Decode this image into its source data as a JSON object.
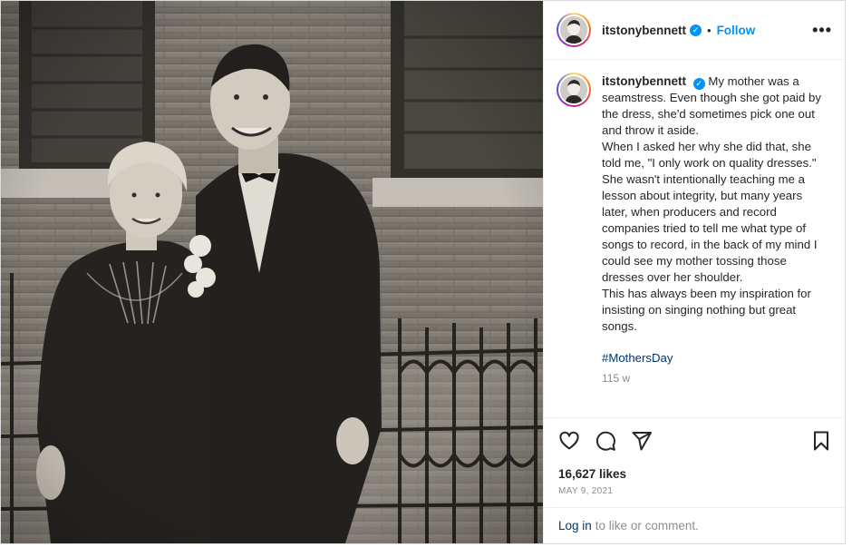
{
  "post": {
    "username": "itstonybennett",
    "verified_badge": "✓",
    "separator": "•",
    "follow_label": "Follow",
    "more_label": "•••",
    "caption": "My mother was a seamstress. Even though she got paid by the dress, she'd sometimes pick one out and throw it aside.\nWhen I asked her why she did that, she told me, \"I only work on quality dresses.\"\nShe wasn't intentionally teaching me a lesson about integrity, but many years later, when producers and record companies tried to tell me what type of songs to record, in the back of my mind I could see my mother tossing those dresses over her shoulder.\nThis has always been my inspiration for insisting on singing nothing but great songs.",
    "hashtag": "#MothersDay",
    "time_ago": "115 w",
    "likes": "16,627 likes",
    "date": "MAY 9, 2021",
    "login_link": "Log in",
    "login_suffix": "to like or comment."
  },
  "icons": {
    "like": "heart-icon",
    "comment": "comment-icon",
    "share": "paper-plane-icon",
    "save": "bookmark-icon",
    "options": "more-icon",
    "verified": "verified-badge-icon"
  },
  "colors": {
    "accent": "#0095f6",
    "hashtag": "#00376b",
    "muted": "#8e8e8e",
    "text": "#262626"
  }
}
